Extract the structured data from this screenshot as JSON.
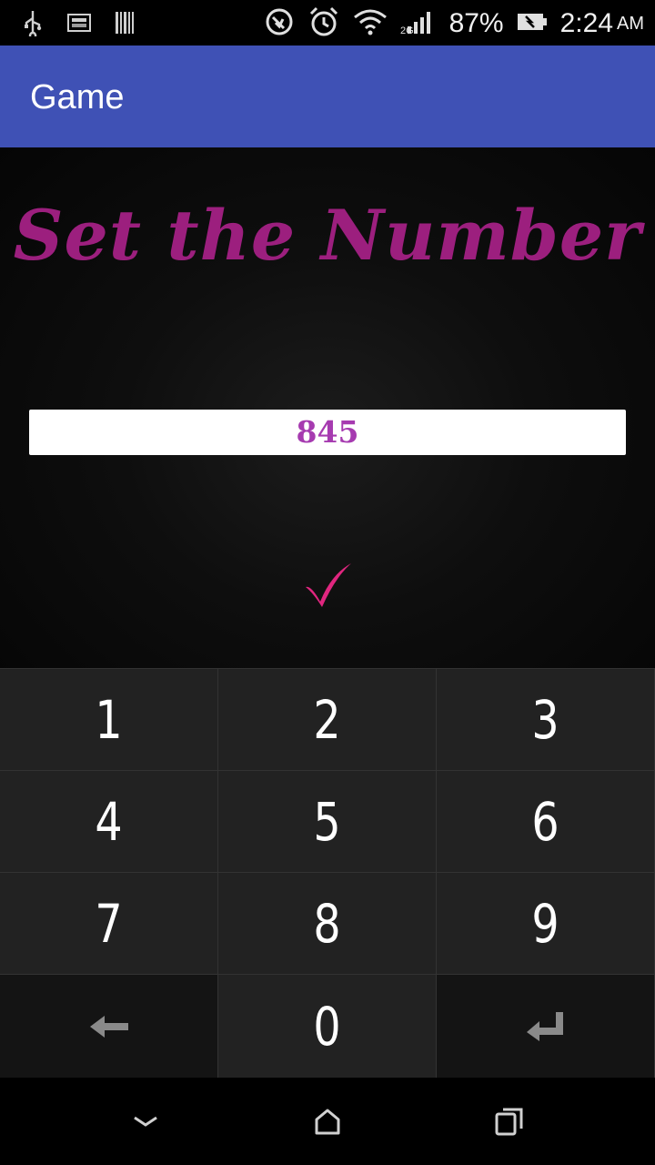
{
  "status_bar": {
    "battery_percent": "87%",
    "time": "2:24",
    "ampm": "AM",
    "icons": [
      "usb-icon",
      "screenshot-icon",
      "barcode-icon",
      "vibrate-icon",
      "alarm-icon",
      "wifi-icon",
      "signal-icon",
      "battery-icon"
    ]
  },
  "app_bar": {
    "title": "Game",
    "color": "#3f51b5"
  },
  "game": {
    "heading": "Set the Number",
    "number_value": "845",
    "confirm_icon": "checkmark-icon",
    "heading_color": "#9c1f7e",
    "number_color": "#a63bb0",
    "check_color": "#e0267f"
  },
  "keypad": {
    "keys": [
      "1",
      "2",
      "3",
      "4",
      "5",
      "6",
      "7",
      "8",
      "9",
      "",
      "0",
      ""
    ],
    "backspace_icon": "arrow-left-icon",
    "enter_icon": "enter-icon"
  },
  "nav_bar": {
    "icons": [
      "back-icon",
      "home-icon",
      "recents-icon"
    ]
  }
}
